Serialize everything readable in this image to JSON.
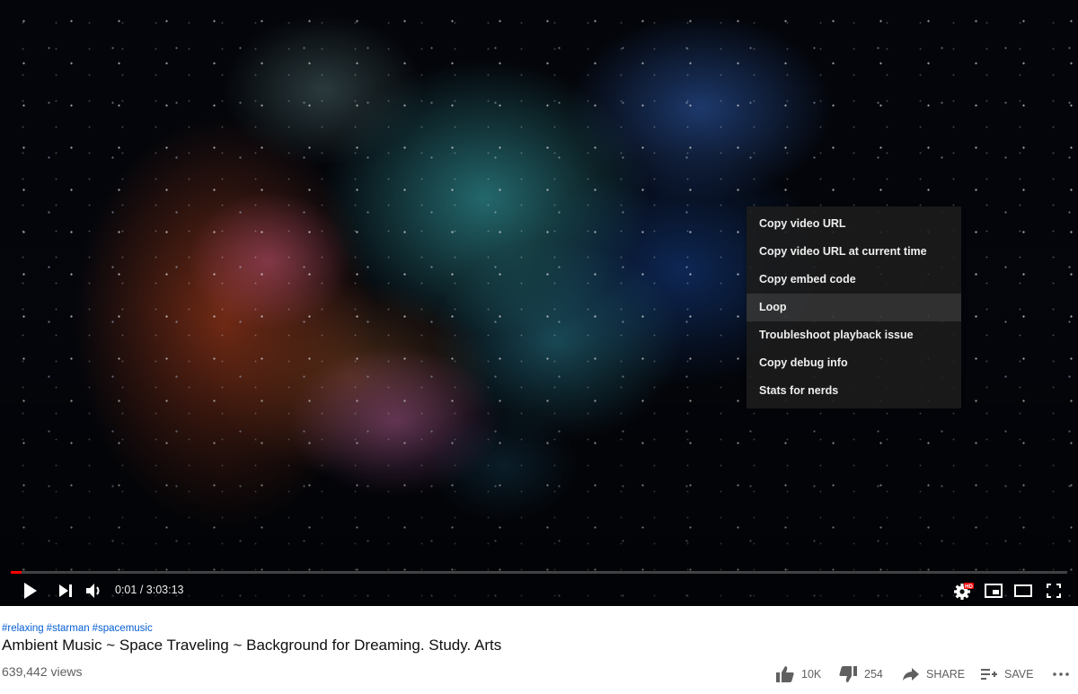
{
  "context_menu": {
    "items": [
      {
        "label": "Copy video URL"
      },
      {
        "label": "Copy video URL at current time"
      },
      {
        "label": "Copy embed code"
      },
      {
        "label": "Loop"
      },
      {
        "label": "Troubleshoot playback issue"
      },
      {
        "label": "Copy debug info"
      },
      {
        "label": "Stats for nerds"
      }
    ],
    "highlighted_item": "Loop"
  },
  "player": {
    "current_time": "0:01",
    "separator": " / ",
    "duration": "3:03:13",
    "progress_fraction": 0.0001,
    "quality_badge": "HD",
    "icons": [
      "play-icon",
      "next-icon",
      "volume-icon",
      "settings-icon",
      "miniplayer-icon",
      "theater-mode-icon",
      "fullscreen-icon"
    ]
  },
  "video": {
    "hashtags": [
      "#relaxing",
      "#starman",
      "#spacemusic"
    ],
    "title": "Ambient Music ~ Space Traveling ~ Background for Dreaming. Study. Arts",
    "views": "639,442 views"
  },
  "actions": {
    "like_count": "10K",
    "dislike_count": "254",
    "share_label": "SHARE",
    "save_label": "SAVE"
  },
  "colors": {
    "accent": "#ff0000",
    "hashtag": "#065fd4",
    "title": "#0f0f0f",
    "secondary_text": "#606060",
    "menu_background": "#1c1c1c"
  }
}
